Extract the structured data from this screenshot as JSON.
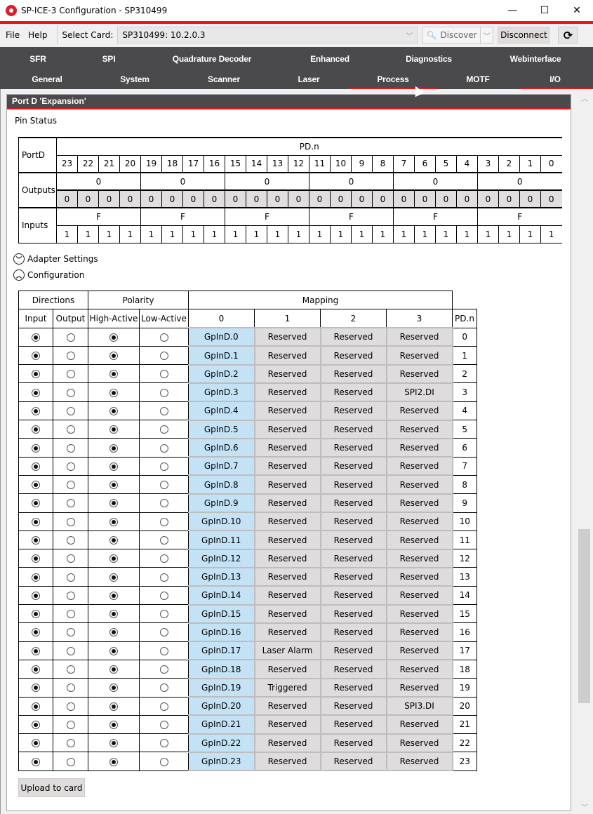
{
  "window": {
    "title": "SP-ICE-3 Configuration - SP310499",
    "minimize": "—",
    "maximize": "☐",
    "close": "✕"
  },
  "colors": {
    "accent_red": "#e8141e",
    "tab_bg": "#4a4a4c",
    "mapping_selected": "#c3e2f5",
    "mapping_other": "#dedcdc"
  },
  "menu": {
    "file": "File",
    "help": "Help"
  },
  "toolbar": {
    "select_card_label": "Select Card:",
    "select_card_value": "SP310499: 10.2.0.3",
    "discover_label": "Discover",
    "disconnect_label": "Disconnect",
    "refresh_icon": "refresh-icon"
  },
  "tabs": {
    "row1": [
      "SFR",
      "SPI",
      "Quadrature Decoder",
      "Enhanced",
      "Diagnostics",
      "Webinterface"
    ],
    "row2": [
      "General",
      "System",
      "Scanner",
      "Laser",
      "Process",
      "MOTF",
      "I/O"
    ],
    "active": "I/O",
    "hovered": "Process"
  },
  "panel": {
    "title": "Port D 'Expansion'",
    "pin_status_label": "Pin Status",
    "pin_table": {
      "port_label": "PortD",
      "group_label": "PD.n",
      "bits": [
        "23",
        "22",
        "21",
        "20",
        "19",
        "18",
        "17",
        "16",
        "15",
        "14",
        "13",
        "12",
        "11",
        "10",
        "9",
        "8",
        "7",
        "6",
        "5",
        "4",
        "3",
        "2",
        "1",
        "0"
      ],
      "outputs_label": "Outputs",
      "outputs_nibbles": [
        "0",
        "0",
        "0",
        "0",
        "0",
        "0"
      ],
      "outputs_bits": [
        "0",
        "0",
        "0",
        "0",
        "0",
        "0",
        "0",
        "0",
        "0",
        "0",
        "0",
        "0",
        "0",
        "0",
        "0",
        "0",
        "0",
        "0",
        "0",
        "0",
        "0",
        "0",
        "0",
        "0"
      ],
      "inputs_label": "Inputs",
      "inputs_nibbles": [
        "F",
        "F",
        "F",
        "F",
        "F",
        "F"
      ],
      "inputs_bits": [
        "1",
        "1",
        "1",
        "1",
        "1",
        "1",
        "1",
        "1",
        "1",
        "1",
        "1",
        "1",
        "1",
        "1",
        "1",
        "1",
        "1",
        "1",
        "1",
        "1",
        "1",
        "1",
        "1",
        "1"
      ]
    },
    "adapter_settings_label": "Adapter Settings",
    "configuration_label": "Configuration",
    "config_table": {
      "headers": {
        "directions": "Directions",
        "polarity": "Polarity",
        "mapping": "Mapping",
        "input": "Input",
        "output": "Output",
        "high_active": "High-Active",
        "low_active": "Low-Active",
        "map0": "0",
        "map1": "1",
        "map2": "2",
        "map3": "3",
        "pdn": "PD.n"
      },
      "rows": [
        {
          "dir": "input",
          "pol": "high",
          "m0": "GpInD.0",
          "m1": "Reserved",
          "m2": "Reserved",
          "m3": "Reserved",
          "pd": "0"
        },
        {
          "dir": "input",
          "pol": "high",
          "m0": "GpInD.1",
          "m1": "Reserved",
          "m2": "Reserved",
          "m3": "Reserved",
          "pd": "1"
        },
        {
          "dir": "input",
          "pol": "high",
          "m0": "GpInD.2",
          "m1": "Reserved",
          "m2": "Reserved",
          "m3": "Reserved",
          "pd": "2"
        },
        {
          "dir": "input",
          "pol": "high",
          "m0": "GpInD.3",
          "m1": "Reserved",
          "m2": "Reserved",
          "m3": "SPI2.DI",
          "pd": "3"
        },
        {
          "dir": "input",
          "pol": "high",
          "m0": "GpInD.4",
          "m1": "Reserved",
          "m2": "Reserved",
          "m3": "Reserved",
          "pd": "4"
        },
        {
          "dir": "input",
          "pol": "high",
          "m0": "GpInD.5",
          "m1": "Reserved",
          "m2": "Reserved",
          "m3": "Reserved",
          "pd": "5"
        },
        {
          "dir": "input",
          "pol": "high",
          "m0": "GpInD.6",
          "m1": "Reserved",
          "m2": "Reserved",
          "m3": "Reserved",
          "pd": "6"
        },
        {
          "dir": "input",
          "pol": "high",
          "m0": "GpInD.7",
          "m1": "Reserved",
          "m2": "Reserved",
          "m3": "Reserved",
          "pd": "7"
        },
        {
          "dir": "input",
          "pol": "high",
          "m0": "GpInD.8",
          "m1": "Reserved",
          "m2": "Reserved",
          "m3": "Reserved",
          "pd": "8"
        },
        {
          "dir": "input",
          "pol": "high",
          "m0": "GpInD.9",
          "m1": "Reserved",
          "m2": "Reserved",
          "m3": "Reserved",
          "pd": "9"
        },
        {
          "dir": "input",
          "pol": "high",
          "m0": "GpInD.10",
          "m1": "Reserved",
          "m2": "Reserved",
          "m3": "Reserved",
          "pd": "10"
        },
        {
          "dir": "input",
          "pol": "high",
          "m0": "GpInD.11",
          "m1": "Reserved",
          "m2": "Reserved",
          "m3": "Reserved",
          "pd": "11"
        },
        {
          "dir": "input",
          "pol": "high",
          "m0": "GpInD.12",
          "m1": "Reserved",
          "m2": "Reserved",
          "m3": "Reserved",
          "pd": "12"
        },
        {
          "dir": "input",
          "pol": "high",
          "m0": "GpInD.13",
          "m1": "Reserved",
          "m2": "Reserved",
          "m3": "Reserved",
          "pd": "13"
        },
        {
          "dir": "input",
          "pol": "high",
          "m0": "GpInD.14",
          "m1": "Reserved",
          "m2": "Reserved",
          "m3": "Reserved",
          "pd": "14"
        },
        {
          "dir": "input",
          "pol": "high",
          "m0": "GpInD.15",
          "m1": "Reserved",
          "m2": "Reserved",
          "m3": "Reserved",
          "pd": "15"
        },
        {
          "dir": "input",
          "pol": "high",
          "m0": "GpInD.16",
          "m1": "Reserved",
          "m2": "Reserved",
          "m3": "Reserved",
          "pd": "16"
        },
        {
          "dir": "input",
          "pol": "high",
          "m0": "GpInD.17",
          "m1": "Laser Alarm",
          "m2": "Reserved",
          "m3": "Reserved",
          "pd": "17"
        },
        {
          "dir": "input",
          "pol": "high",
          "m0": "GpInD.18",
          "m1": "Reserved",
          "m2": "Reserved",
          "m3": "Reserved",
          "pd": "18"
        },
        {
          "dir": "input",
          "pol": "high",
          "m0": "GpInD.19",
          "m1": "Triggered",
          "m2": "Reserved",
          "m3": "Reserved",
          "pd": "19"
        },
        {
          "dir": "input",
          "pol": "high",
          "m0": "GpInD.20",
          "m1": "Reserved",
          "m2": "Reserved",
          "m3": "SPI3.DI",
          "pd": "20"
        },
        {
          "dir": "input",
          "pol": "high",
          "m0": "GpInD.21",
          "m1": "Reserved",
          "m2": "Reserved",
          "m3": "Reserved",
          "pd": "21"
        },
        {
          "dir": "input",
          "pol": "high",
          "m0": "GpInD.22",
          "m1": "Reserved",
          "m2": "Reserved",
          "m3": "Reserved",
          "pd": "22"
        },
        {
          "dir": "input",
          "pol": "high",
          "m0": "GpInD.23",
          "m1": "Reserved",
          "m2": "Reserved",
          "m3": "Reserved",
          "pd": "23"
        }
      ]
    },
    "upload_label": "Upload to card"
  }
}
